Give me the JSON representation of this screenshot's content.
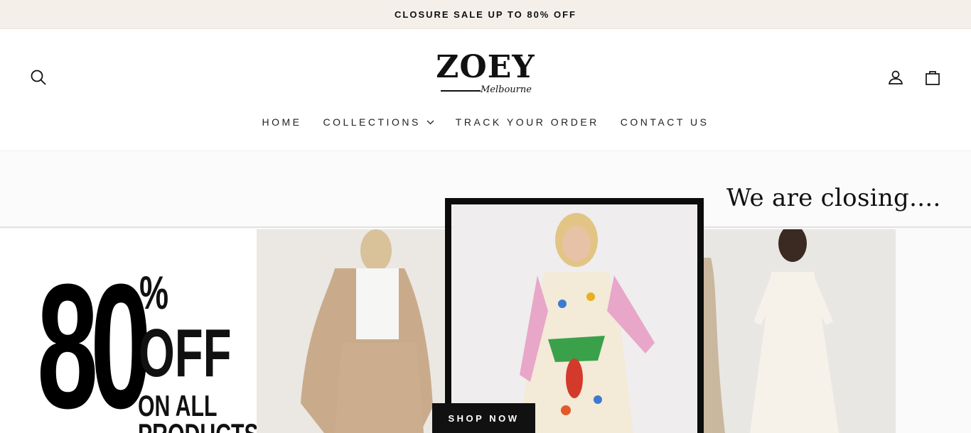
{
  "announcement": {
    "text": "CLOSURE SALE UP TO 80% OFF"
  },
  "header": {
    "logo": {
      "main": "ZOEY",
      "sub": "Melbourne"
    },
    "icons": {
      "search": "search-icon",
      "account": "user-icon",
      "cart": "shopping-bag-icon"
    }
  },
  "nav": {
    "items": [
      {
        "label": "HOME"
      },
      {
        "label": "COLLECTIONS",
        "has_dropdown": true
      },
      {
        "label": "TRACK YOUR ORDER"
      },
      {
        "label": "CONTACT US"
      }
    ]
  },
  "hero": {
    "headline": "We are closing....",
    "promo": {
      "number": "80",
      "percent": "%",
      "off": "OFF",
      "line1": "ON ALL",
      "line2": "PRODUCTS"
    },
    "cta": "SHOP NOW"
  },
  "colors": {
    "announcement_bg": "#f4efe8",
    "accent": "#111111"
  }
}
